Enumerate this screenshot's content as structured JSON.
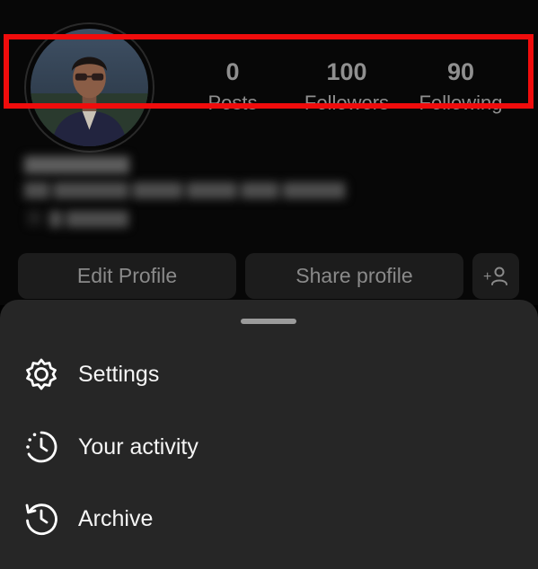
{
  "profile": {
    "stats": [
      {
        "value": "0",
        "label": "Posts"
      },
      {
        "value": "100",
        "label": "Followers"
      },
      {
        "value": "90",
        "label": "Following"
      }
    ],
    "buttons": {
      "edit": "Edit Profile",
      "share": "Share profile"
    }
  },
  "menu": {
    "items": [
      {
        "label": "Settings",
        "icon": "gear-icon",
        "highlighted": true
      },
      {
        "label": "Your activity",
        "icon": "activity-clock-icon"
      },
      {
        "label": "Archive",
        "icon": "archive-history-icon"
      }
    ]
  },
  "colors": {
    "sheet_bg": "#262626",
    "highlight": "#f00c0c",
    "button_bg": "#1c1c1c"
  }
}
